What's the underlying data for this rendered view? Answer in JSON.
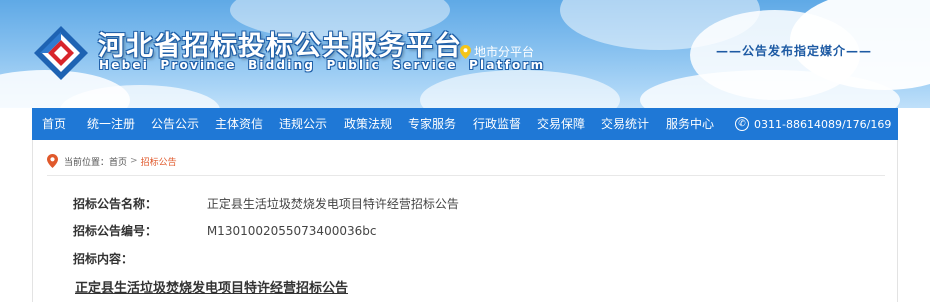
{
  "header": {
    "site_title": "河北省招标投标公共服务平台",
    "site_subtitle": "Hebei Province Bidding Public Service Platform",
    "city_switch": "地市分平台",
    "slogan": "——公告发布指定媒介——"
  },
  "nav": {
    "items": [
      {
        "label": "首页"
      },
      {
        "label": "统一注册"
      },
      {
        "label": "公告公示"
      },
      {
        "label": "主体资信"
      },
      {
        "label": "违规公示"
      },
      {
        "label": "政策法规"
      },
      {
        "label": "专家服务"
      },
      {
        "label": "行政监督"
      },
      {
        "label": "交易保障"
      },
      {
        "label": "交易统计"
      },
      {
        "label": "服务中心"
      }
    ],
    "phone": "0311-88614089/176/169"
  },
  "breadcrumb": {
    "prefix": "当前位置：",
    "home": "首页",
    "separator": ">",
    "current": "招标公告"
  },
  "detail": {
    "name_label": "招标公告名称：",
    "name_value": "正定县生活垃圾焚烧发电项目特许经营招标公告",
    "code_label": "招标公告编号：",
    "code_value": "M1301002055073400036bc",
    "content_label": "招标内容：",
    "notice_title": "正定县生活垃圾焚烧发电项目特许经营招标公告"
  },
  "colors": {
    "nav_bg": "#1f78d6",
    "accent_orange": "#e0592b",
    "slogan_blue": "#1d5aa3"
  }
}
